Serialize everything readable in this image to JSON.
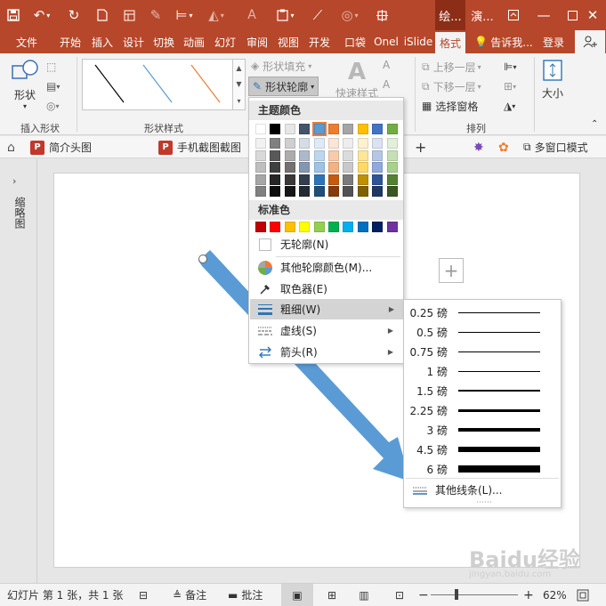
{
  "colors": {
    "accent": "#b7472a",
    "accent_dark": "#8c2e17",
    "shape_blue": "#5b9bd5",
    "shape_orange": "#ed7d31"
  },
  "titlebar": {
    "qat_icons": [
      "save-icon",
      "undo-icon",
      "redo-icon",
      "new-file-icon",
      "layout-icon",
      "pen-icon",
      "align-icon",
      "paint-icon",
      "text-icon",
      "paste-icon",
      "brush-icon",
      "circle-icon",
      "crop-icon"
    ],
    "context_tabs": [
      "绘...",
      "演..."
    ],
    "window_controls": [
      "ribbon-display-icon",
      "minimize-icon",
      "maximize-icon",
      "close-icon"
    ]
  },
  "ribbon_tabs": [
    "文件",
    "开始",
    "插入",
    "设计",
    "切换",
    "动画",
    "幻灯",
    "审阅",
    "视图",
    "开发",
    "口袋",
    "Onel",
    "iSlide",
    "格式"
  ],
  "ribbon_tabs_active": "格式",
  "tell_me": "告诉我...",
  "login": "登录",
  "ribbon": {
    "insert_shapes": {
      "shapes_label": "形状",
      "group_label": "插入形状"
    },
    "shape_styles": {
      "fill_label": "形状填充",
      "outline_label": "形状轮廓",
      "quick_styles_label": "快速样式",
      "group_label": "形状样式"
    },
    "arrange": {
      "bring_forward": "上移一层",
      "send_backward": "下移一层",
      "selection_pane": "选择窗格",
      "group_label": "排列"
    },
    "size": {
      "label": "大小"
    }
  },
  "docbar": {
    "tab1": "简介头图",
    "tab2": "手机截图截图",
    "multi_window": "多窗口模式",
    "add_tab": "+"
  },
  "left_pane_label": "缩略图",
  "outline_menu": {
    "theme_colors_label": "主题颜色",
    "theme_colors": [
      "#ffffff",
      "#000000",
      "#e7e6e6",
      "#44546a",
      "#5b9bd5",
      "#ed7d31",
      "#a5a5a5",
      "#ffc000",
      "#4472c4",
      "#70ad47"
    ],
    "theme_tints": [
      [
        "#f2f2f2",
        "#d9d9d9",
        "#bfbfbf",
        "#a6a6a6",
        "#808080"
      ],
      [
        "#808080",
        "#595959",
        "#404040",
        "#262626",
        "#0d0d0d"
      ],
      [
        "#d0cece",
        "#aeabab",
        "#757171",
        "#3b3838",
        "#171616"
      ],
      [
        "#d6dce4",
        "#adb9ca",
        "#8497b0",
        "#333f4f",
        "#222a35"
      ],
      [
        "#deebf7",
        "#bdd7ee",
        "#9dc3e6",
        "#2e75b6",
        "#1f4e79"
      ],
      [
        "#fbe5d6",
        "#f8cbad",
        "#f4b183",
        "#c55a11",
        "#843c0c"
      ],
      [
        "#ededed",
        "#dbdbdb",
        "#c9c9c9",
        "#7b7b7b",
        "#525252"
      ],
      [
        "#fff2cc",
        "#ffe699",
        "#ffd966",
        "#bf9000",
        "#7f6000"
      ],
      [
        "#dae3f3",
        "#b4c7e7",
        "#8faadc",
        "#2f5597",
        "#203864"
      ],
      [
        "#e2f0d9",
        "#c5e0b4",
        "#a9d18e",
        "#548235",
        "#385723"
      ]
    ],
    "standard_colors_label": "标准色",
    "standard_colors": [
      "#c00000",
      "#ff0000",
      "#ffc000",
      "#ffff00",
      "#92d050",
      "#00b050",
      "#00b0f0",
      "#0070c0",
      "#002060",
      "#7030a0"
    ],
    "no_outline": "无轮廓(N)",
    "more_colors": "其他轮廓颜色(M)...",
    "eyedropper": "取色器(E)",
    "weight": "粗细(W)",
    "dashes": "虚线(S)",
    "arrows": "箭头(R)"
  },
  "weight_menu": {
    "items": [
      {
        "label": "0.25 磅",
        "weight": 0.25
      },
      {
        "label": "0.5 磅",
        "weight": 0.5
      },
      {
        "label": "0.75 磅",
        "weight": 0.75
      },
      {
        "label": "1 磅",
        "weight": 1
      },
      {
        "label": "1.5 磅",
        "weight": 1.5
      },
      {
        "label": "2.25 磅",
        "weight": 2.25
      },
      {
        "label": "3 磅",
        "weight": 3
      },
      {
        "label": "4.5 磅",
        "weight": 4.5
      },
      {
        "label": "6 磅",
        "weight": 6
      }
    ],
    "more_lines": "其他线条(L)...",
    "more_dots": "⋯⋯"
  },
  "statusbar": {
    "slide_info": "幻灯片 第 1 张，共 1 张",
    "notes": "备注",
    "comments": "批注",
    "zoom_minus": "−",
    "zoom_plus": "+",
    "zoom": "62%",
    "zoom_level_percent": 62
  },
  "watermark": "Baidu经验",
  "watermark_sub": "jingyan.baidu.com"
}
